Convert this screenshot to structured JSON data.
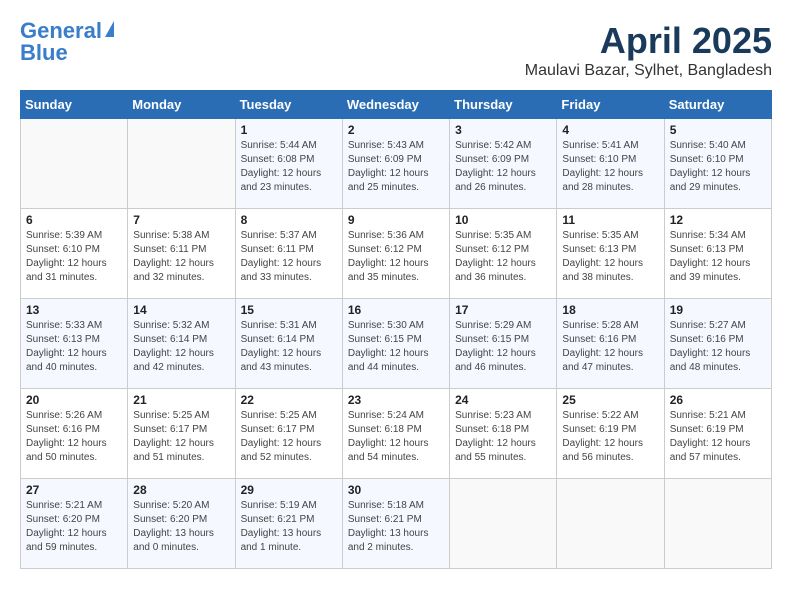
{
  "header": {
    "logo_line1": "General",
    "logo_line2": "Blue",
    "title": "April 2025",
    "subtitle": "Maulavi Bazar, Sylhet, Bangladesh"
  },
  "calendar": {
    "weekdays": [
      "Sunday",
      "Monday",
      "Tuesday",
      "Wednesday",
      "Thursday",
      "Friday",
      "Saturday"
    ],
    "weeks": [
      [
        {
          "day": "",
          "info": ""
        },
        {
          "day": "",
          "info": ""
        },
        {
          "day": "1",
          "info": "Sunrise: 5:44 AM\nSunset: 6:08 PM\nDaylight: 12 hours\nand 23 minutes."
        },
        {
          "day": "2",
          "info": "Sunrise: 5:43 AM\nSunset: 6:09 PM\nDaylight: 12 hours\nand 25 minutes."
        },
        {
          "day": "3",
          "info": "Sunrise: 5:42 AM\nSunset: 6:09 PM\nDaylight: 12 hours\nand 26 minutes."
        },
        {
          "day": "4",
          "info": "Sunrise: 5:41 AM\nSunset: 6:10 PM\nDaylight: 12 hours\nand 28 minutes."
        },
        {
          "day": "5",
          "info": "Sunrise: 5:40 AM\nSunset: 6:10 PM\nDaylight: 12 hours\nand 29 minutes."
        }
      ],
      [
        {
          "day": "6",
          "info": "Sunrise: 5:39 AM\nSunset: 6:10 PM\nDaylight: 12 hours\nand 31 minutes."
        },
        {
          "day": "7",
          "info": "Sunrise: 5:38 AM\nSunset: 6:11 PM\nDaylight: 12 hours\nand 32 minutes."
        },
        {
          "day": "8",
          "info": "Sunrise: 5:37 AM\nSunset: 6:11 PM\nDaylight: 12 hours\nand 33 minutes."
        },
        {
          "day": "9",
          "info": "Sunrise: 5:36 AM\nSunset: 6:12 PM\nDaylight: 12 hours\nand 35 minutes."
        },
        {
          "day": "10",
          "info": "Sunrise: 5:35 AM\nSunset: 6:12 PM\nDaylight: 12 hours\nand 36 minutes."
        },
        {
          "day": "11",
          "info": "Sunrise: 5:35 AM\nSunset: 6:13 PM\nDaylight: 12 hours\nand 38 minutes."
        },
        {
          "day": "12",
          "info": "Sunrise: 5:34 AM\nSunset: 6:13 PM\nDaylight: 12 hours\nand 39 minutes."
        }
      ],
      [
        {
          "day": "13",
          "info": "Sunrise: 5:33 AM\nSunset: 6:13 PM\nDaylight: 12 hours\nand 40 minutes."
        },
        {
          "day": "14",
          "info": "Sunrise: 5:32 AM\nSunset: 6:14 PM\nDaylight: 12 hours\nand 42 minutes."
        },
        {
          "day": "15",
          "info": "Sunrise: 5:31 AM\nSunset: 6:14 PM\nDaylight: 12 hours\nand 43 minutes."
        },
        {
          "day": "16",
          "info": "Sunrise: 5:30 AM\nSunset: 6:15 PM\nDaylight: 12 hours\nand 44 minutes."
        },
        {
          "day": "17",
          "info": "Sunrise: 5:29 AM\nSunset: 6:15 PM\nDaylight: 12 hours\nand 46 minutes."
        },
        {
          "day": "18",
          "info": "Sunrise: 5:28 AM\nSunset: 6:16 PM\nDaylight: 12 hours\nand 47 minutes."
        },
        {
          "day": "19",
          "info": "Sunrise: 5:27 AM\nSunset: 6:16 PM\nDaylight: 12 hours\nand 48 minutes."
        }
      ],
      [
        {
          "day": "20",
          "info": "Sunrise: 5:26 AM\nSunset: 6:16 PM\nDaylight: 12 hours\nand 50 minutes."
        },
        {
          "day": "21",
          "info": "Sunrise: 5:25 AM\nSunset: 6:17 PM\nDaylight: 12 hours\nand 51 minutes."
        },
        {
          "day": "22",
          "info": "Sunrise: 5:25 AM\nSunset: 6:17 PM\nDaylight: 12 hours\nand 52 minutes."
        },
        {
          "day": "23",
          "info": "Sunrise: 5:24 AM\nSunset: 6:18 PM\nDaylight: 12 hours\nand 54 minutes."
        },
        {
          "day": "24",
          "info": "Sunrise: 5:23 AM\nSunset: 6:18 PM\nDaylight: 12 hours\nand 55 minutes."
        },
        {
          "day": "25",
          "info": "Sunrise: 5:22 AM\nSunset: 6:19 PM\nDaylight: 12 hours\nand 56 minutes."
        },
        {
          "day": "26",
          "info": "Sunrise: 5:21 AM\nSunset: 6:19 PM\nDaylight: 12 hours\nand 57 minutes."
        }
      ],
      [
        {
          "day": "27",
          "info": "Sunrise: 5:21 AM\nSunset: 6:20 PM\nDaylight: 12 hours\nand 59 minutes."
        },
        {
          "day": "28",
          "info": "Sunrise: 5:20 AM\nSunset: 6:20 PM\nDaylight: 13 hours\nand 0 minutes."
        },
        {
          "day": "29",
          "info": "Sunrise: 5:19 AM\nSunset: 6:21 PM\nDaylight: 13 hours\nand 1 minute."
        },
        {
          "day": "30",
          "info": "Sunrise: 5:18 AM\nSunset: 6:21 PM\nDaylight: 13 hours\nand 2 minutes."
        },
        {
          "day": "",
          "info": ""
        },
        {
          "day": "",
          "info": ""
        },
        {
          "day": "",
          "info": ""
        }
      ]
    ]
  }
}
